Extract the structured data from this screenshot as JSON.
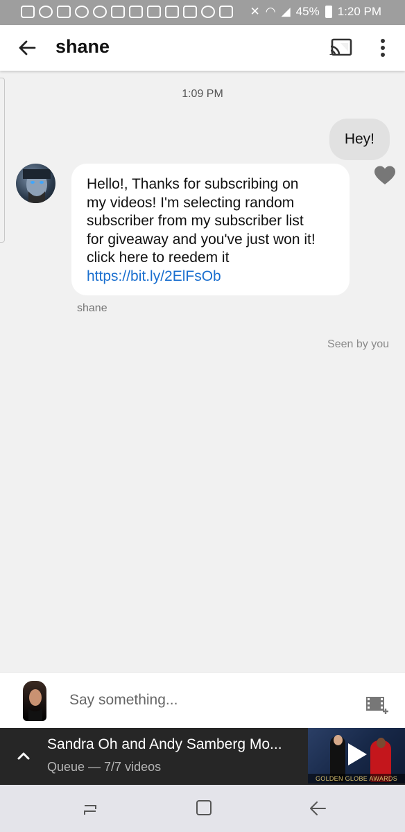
{
  "status_bar": {
    "battery": "45%",
    "time": "1:20 PM"
  },
  "app_bar": {
    "title": "shane"
  },
  "chat": {
    "timestamp": "1:09 PM",
    "my_message": "Hey!",
    "their_message_lines": [
      "Hello!, Thanks for subscribing on",
      "my videos! I'm selecting random",
      "subscriber from my subscriber list",
      "for giveaway and you've just won it!",
      "click here to reedem it"
    ],
    "their_link": "https://bit.ly/2ElFsOb",
    "sender": "shane",
    "seen": "Seen by you"
  },
  "composer": {
    "placeholder": "Say something..."
  },
  "mini_player": {
    "title": "Sandra Oh and Andy Samberg Mo...",
    "queue": "Queue — 7/7 videos",
    "thumbnail_caption": "GOLDEN GLOBE AWARDS"
  },
  "colors": {
    "link": "#1a6fcf",
    "my_bubble": "#e1e1e1",
    "background": "#f1f1f1"
  }
}
